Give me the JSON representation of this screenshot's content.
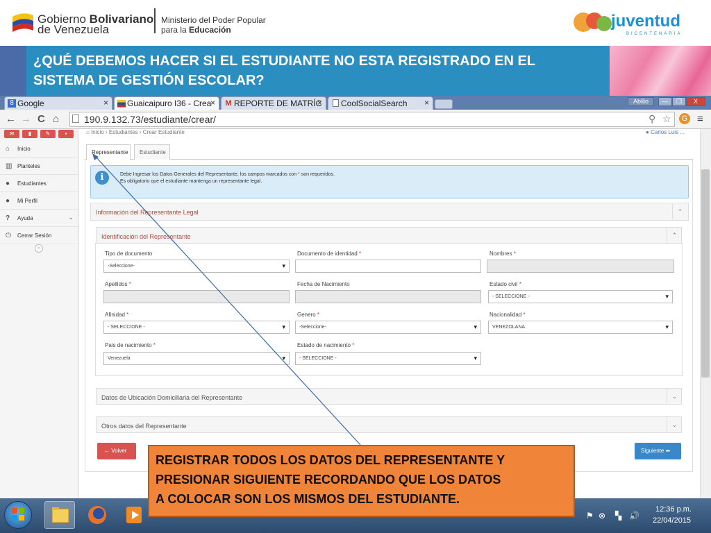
{
  "header": {
    "gov_brand_1": "Gobierno",
    "gov_brand_1_bold": "Bolivariano",
    "gov_brand_2": "de Venezuela",
    "ministry_1": "Ministerio  del Poder Popular",
    "ministry_2_prefix": "para la ",
    "ministry_2_bold": "Educación",
    "right_logo_brand": "juventud",
    "right_logo_sub": "BICENTENARIA"
  },
  "banner": {
    "title_line1": "¿QUÉ DEBEMOS HACER SI EL ESTUDIANTE NO ESTA REGISTRADO EN EL",
    "title_line2": "SISTEMA DE GESTIÓN ESCOLAR?"
  },
  "browser": {
    "tabs": [
      {
        "label": "Google",
        "icon": "8"
      },
      {
        "label": "Guaicaipuro I36 - Crea",
        "icon": "flag"
      },
      {
        "label": "REPORTE DE MATRÍC",
        "icon": "M"
      },
      {
        "label": "CoolSocialSearch",
        "icon": "page"
      }
    ],
    "user_chip": "Abilio",
    "url": "190.9.132.73/estudiante/crear/"
  },
  "app": {
    "breadcrumb": "Inicio  ›  Estudiantes  ›  Crear Estudiante",
    "user": "Carlos Luis ...",
    "sidebar": [
      {
        "label": "Inicio",
        "icon": "home-icon"
      },
      {
        "label": "Planteles",
        "icon": "institution-icon"
      },
      {
        "label": "Estudiantes",
        "icon": "users-icon"
      },
      {
        "label": "Mi Perfil",
        "icon": "user-icon"
      },
      {
        "label": "Ayuda",
        "icon": "help-icon"
      },
      {
        "label": "Cerrar Sesión",
        "icon": "power-icon"
      }
    ],
    "form_tabs": [
      "Representante",
      "Estudiante"
    ],
    "info_line1_a": "Debe Ingresar los Datos Generales del Representante, los campos marcados con ",
    "info_line1_star": "*",
    "info_line1_b": " son requeridos.",
    "info_line2": "Es obligatorio que el estudiante mantenga un representante legal.",
    "section_legal": "Información del Representante Legal",
    "section_ident": "Identificación del Representante",
    "section_domicilio": "Datos de Ubicación Domiciliaria del Representante",
    "section_otros": "Otros datos del Representante",
    "fields": {
      "tipo_documento": {
        "label": "Tipo de documento",
        "value": "-Seleccione-"
      },
      "documento": {
        "label": "Documento de identidad",
        "required": "*"
      },
      "nombres": {
        "label": "Nombres",
        "required": "*"
      },
      "apellidos": {
        "label": "Apellidos",
        "required": "*"
      },
      "fecha_nac": {
        "label": "Fecha de Nacimiento"
      },
      "estado_civil": {
        "label": "Estado civil",
        "required": "*",
        "value": "- SELECCIONE -"
      },
      "afinidad": {
        "label": "Afinidad",
        "required": "*",
        "value": "- SELECCIONE -"
      },
      "genero": {
        "label": "Genero",
        "required": "*",
        "value": "-Seleccione-"
      },
      "nacionalidad": {
        "label": "Nacionalidad",
        "required": "*",
        "value": "VENEZOLANA"
      },
      "pais_nac": {
        "label": "Pais de nacimiento",
        "required": "*",
        "value": "Venezuela"
      },
      "estado_nac": {
        "label": "Estado de nacimiento",
        "required": "*",
        "value": "- SELECCIONE -"
      }
    },
    "btn_volver": "Volver",
    "btn_siguiente": "Siguiente"
  },
  "callout": {
    "line1": "REGISTRAR TODOS LOS DATOS DEL REPRESENTANTE Y",
    "line2": "PRESIONAR SIGUIENTE RECORDANDO QUE LOS DATOS",
    "line3": "A COLOCAR SON LOS  MISMOS DEL ESTUDIANTE."
  },
  "taskbar": {
    "time": "12:36 p.m.",
    "date": "22/04/2015"
  },
  "colors": {
    "banner": "#2a8fc0",
    "callout": "#f0853a",
    "primary": "#3a87c9",
    "danger": "#d9534f",
    "section_title": "#b04a3c"
  }
}
